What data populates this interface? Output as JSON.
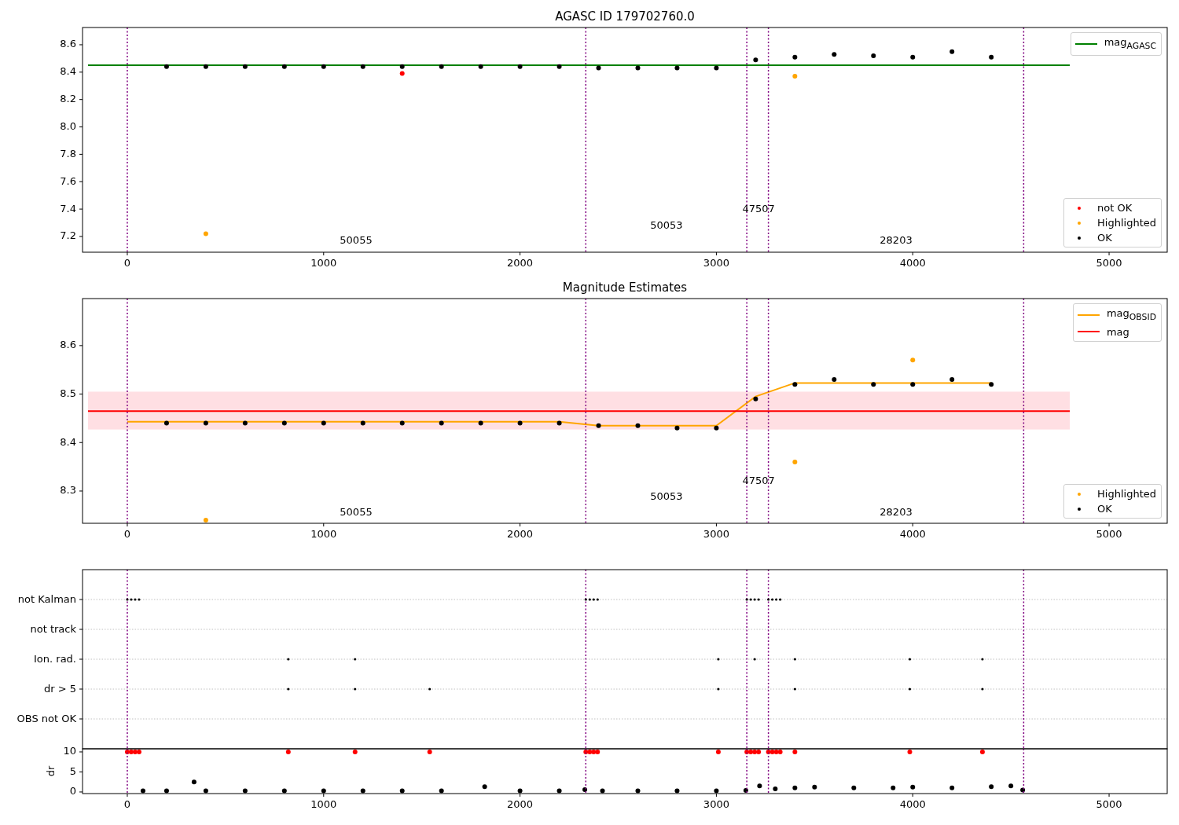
{
  "figure": {
    "panels": [
      {
        "title": "AGASC ID 179702760.0",
        "chart_data": {
          "type": "scatter",
          "xlim": [
            -228,
            5296
          ],
          "ylim": [
            7.085,
            8.726
          ],
          "xticks": [
            0,
            1000,
            2000,
            3000,
            4000,
            5000
          ],
          "yticks": [
            {
              "value": 7.2,
              "label": "7.2"
            },
            {
              "value": 7.4,
              "label": "7.4"
            },
            {
              "value": 7.6,
              "label": "7.6"
            },
            {
              "value": 7.8,
              "label": "7.8"
            },
            {
              "value": 8.0,
              "label": "8.0"
            },
            {
              "value": 8.2,
              "label": "8.2"
            },
            {
              "value": 8.4,
              "label": "8.4"
            },
            {
              "value": 8.6,
              "label": "8.6"
            }
          ],
          "x": [
            -200,
            0,
            200,
            400,
            600,
            800,
            1000,
            1200,
            1400,
            1600,
            1800,
            2000,
            2200,
            2400,
            2600,
            2800,
            3000,
            3200,
            3400,
            3600,
            3800,
            4000,
            4200,
            4400,
            4600,
            4800
          ],
          "series": [
            {
              "name": "mag$_{AGASC}$",
              "type": "line",
              "color": "#008000",
              "values": [
                8.45,
                8.45,
                8.45,
                8.45,
                8.45,
                8.45,
                8.45,
                8.45,
                8.45,
                8.45,
                8.45,
                8.45,
                8.45,
                8.45,
                8.45,
                8.45,
                8.45,
                8.45,
                8.45,
                8.45,
                8.45,
                8.45,
                8.45,
                8.45,
                8.45,
                8.45
              ]
            },
            {
              "name": "not OK",
              "type": "scatter",
              "color": "#ff0000",
              "values": [
                null,
                null,
                null,
                null,
                null,
                null,
                null,
                null,
                8.39,
                null,
                null,
                null,
                null,
                null,
                null,
                null,
                null,
                null,
                null,
                null,
                null,
                null,
                null,
                null,
                null,
                null
              ]
            },
            {
              "name": "Highlighted",
              "type": "scatter",
              "color": "#ffa500",
              "values": [
                null,
                null,
                null,
                7.22,
                null,
                null,
                null,
                null,
                null,
                null,
                null,
                null,
                null,
                null,
                null,
                null,
                null,
                null,
                8.37,
                null,
                null,
                null,
                null,
                null,
                null,
                null
              ]
            },
            {
              "name": "OK",
              "type": "scatter",
              "color": "#000000",
              "values": [
                null,
                null,
                8.44,
                8.44,
                8.44,
                8.44,
                8.44,
                8.44,
                8.44,
                8.44,
                8.44,
                8.44,
                8.44,
                8.43,
                8.43,
                8.43,
                8.43,
                8.49,
                8.51,
                8.53,
                8.52,
                8.51,
                8.55,
                8.51,
                null,
                null
              ]
            }
          ],
          "ref_lines": [
            {
              "axis": "x",
              "value": 0
            },
            {
              "axis": "x",
              "value": 2335
            },
            {
              "axis": "x",
              "value": 3155
            },
            {
              "axis": "x",
              "value": 3265
            },
            {
              "axis": "x",
              "value": 4565
            }
          ],
          "annotations": [
            "50055",
            "50053",
            "47507",
            "28203"
          ]
        }
      },
      {
        "title": "Magnitude Estimates",
        "chart_data": {
          "type": "scatter",
          "xlim": [
            -228,
            5296
          ],
          "ylim": [
            8.2335,
            8.697
          ],
          "xticks": [
            0,
            1000,
            2000,
            3000,
            4000,
            5000
          ],
          "yticks": [
            {
              "value": 8.3,
              "label": "8.3"
            },
            {
              "value": 8.4,
              "label": "8.4"
            },
            {
              "value": 8.5,
              "label": "8.5"
            },
            {
              "value": 8.6,
              "label": "8.6"
            }
          ],
          "x": [
            -200,
            0,
            200,
            400,
            600,
            800,
            1000,
            1200,
            1400,
            1600,
            1800,
            2000,
            2200,
            2400,
            2600,
            2800,
            3000,
            3200,
            3400,
            3600,
            3800,
            4000,
            4200,
            4400,
            4600,
            4800
          ],
          "series": [
            {
              "name": "mag$_{OBSID}$",
              "type": "line",
              "color": "#ffa500",
              "values": [
                null,
                8.443,
                8.443,
                8.443,
                8.443,
                8.443,
                8.443,
                8.443,
                8.443,
                8.443,
                8.443,
                8.443,
                8.443,
                8.435,
                8.435,
                8.435,
                8.435,
                8.495,
                8.523,
                8.523,
                8.523,
                8.523,
                8.523,
                8.523,
                null,
                null
              ]
            },
            {
              "name": "mag",
              "type": "line",
              "color": "#ff0000",
              "values": [
                8.465,
                8.465,
                8.465,
                8.465,
                8.465,
                8.465,
                8.465,
                8.465,
                8.465,
                8.465,
                8.465,
                8.465,
                8.465,
                8.465,
                8.465,
                8.465,
                8.465,
                8.465,
                8.465,
                8.465,
                8.465,
                8.465,
                8.465,
                8.465,
                8.465,
                8.465
              ]
            },
            {
              "name": "Highlighted",
              "type": "scatter",
              "color": "#ffa500",
              "values": [
                null,
                null,
                null,
                8.24,
                null,
                null,
                null,
                null,
                null,
                null,
                null,
                null,
                null,
                null,
                null,
                null,
                null,
                null,
                8.36,
                null,
                null,
                8.57,
                null,
                null,
                null,
                null
              ]
            },
            {
              "name": "OK",
              "type": "scatter",
              "color": "#000000",
              "values": [
                null,
                null,
                8.44,
                8.44,
                8.44,
                8.44,
                8.44,
                8.44,
                8.44,
                8.44,
                8.44,
                8.44,
                8.44,
                8.435,
                8.435,
                8.43,
                8.43,
                8.49,
                8.52,
                8.53,
                8.52,
                8.52,
                8.53,
                8.52,
                null,
                null
              ]
            }
          ],
          "bands": [
            {
              "axis": "y",
              "from": 8.427,
              "to": 8.505
            }
          ],
          "ref_lines": [
            {
              "axis": "x",
              "value": 0
            },
            {
              "axis": "x",
              "value": 2335
            },
            {
              "axis": "x",
              "value": 3155
            },
            {
              "axis": "x",
              "value": 3265
            },
            {
              "axis": "x",
              "value": 4565
            }
          ],
          "annotations": [
            "50055",
            "50053",
            "47507",
            "28203"
          ]
        }
      },
      {
        "flags": [
          {
            "label": "not Kalman"
          },
          {
            "label": "not track"
          },
          {
            "label": "Ion. rad."
          },
          {
            "label": "dr > 5"
          },
          {
            "label": "OBS not OK"
          }
        ]
      },
      {
        "chart_data": {
          "type": "scatter",
          "xlim": [
            -228,
            5296
          ],
          "ylim": [
            -0.4,
            10.78
          ],
          "ylabel": "dr",
          "xticks": [
            0,
            1000,
            2000,
            3000,
            4000,
            5000
          ],
          "yticks": [
            0,
            5,
            10
          ],
          "x": [
            0,
            20,
            40,
            60,
            80,
            200,
            340,
            400,
            600,
            800,
            820,
            1000,
            1160,
            1200,
            1400,
            1540,
            1600,
            1820,
            2000,
            2200,
            2330,
            2335,
            2355,
            2375,
            2395,
            2420,
            2600,
            2800,
            3000,
            3010,
            3150,
            3155,
            3175,
            3195,
            3215,
            3220,
            3265,
            3285,
            3300,
            3305,
            3325,
            3400,
            3500,
            3700,
            3900,
            3985,
            4000,
            4200,
            4355,
            4400,
            4500,
            4560
          ],
          "series": [
            {
              "type": "scatter",
              "color": "#ff0000",
              "values": [
                10,
                10,
                10,
                10,
                null,
                null,
                null,
                null,
                null,
                null,
                10,
                null,
                10,
                null,
                null,
                10,
                null,
                null,
                null,
                null,
                null,
                10,
                10,
                10,
                10,
                null,
                null,
                null,
                null,
                10,
                null,
                10,
                10,
                10,
                10,
                null,
                10,
                10,
                null,
                10,
                10,
                10,
                null,
                null,
                null,
                10,
                null,
                null,
                10,
                null,
                null,
                null
              ]
            },
            {
              "type": "scatter",
              "color": "#000000",
              "values": [
                null,
                null,
                null,
                null,
                0.3,
                0.3,
                2.5,
                0.3,
                0.3,
                0.3,
                null,
                0.3,
                null,
                0.3,
                0.3,
                null,
                0.3,
                1.3,
                0.3,
                0.3,
                0.6,
                null,
                null,
                null,
                null,
                0.3,
                0.3,
                0.3,
                0.3,
                null,
                0.4,
                null,
                null,
                null,
                null,
                1.5,
                null,
                null,
                0.8,
                null,
                null,
                1.0,
                1.2,
                1.0,
                1.0,
                null,
                1.2,
                1.0,
                null,
                1.3,
                1.5,
                0.5
              ]
            }
          ],
          "ref_lines": [
            {
              "axis": "x",
              "value": 0
            },
            {
              "axis": "x",
              "value": 2335
            },
            {
              "axis": "x",
              "value": 3155
            },
            {
              "axis": "x",
              "value": 3265
            },
            {
              "axis": "x",
              "value": 4565
            }
          ]
        }
      }
    ]
  }
}
